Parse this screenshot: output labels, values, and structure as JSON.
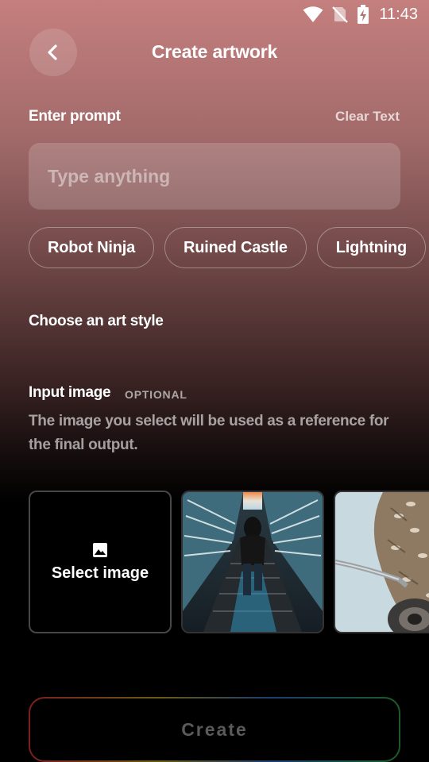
{
  "status_bar": {
    "time": "11:43",
    "icons": [
      "wifi-icon",
      "no-sim-icon",
      "battery-charging-icon"
    ]
  },
  "header": {
    "back_icon": "chevron-left-icon",
    "title": "Create artwork"
  },
  "prompt": {
    "label": "Enter prompt",
    "clear_label": "Clear Text",
    "placeholder": "Type anything",
    "value": ""
  },
  "suggestions": [
    "Robot Ninja",
    "Ruined Castle",
    "Lightning"
  ],
  "art_style": {
    "label": "Choose an art style"
  },
  "input_image": {
    "label": "Input image",
    "badge": "OPTIONAL",
    "description": "The image you select will be used as a reference for the final output.",
    "select_label": "Select image",
    "select_icon": "image-icon",
    "samples": [
      "photo-escalator",
      "photo-owl"
    ]
  },
  "actions": {
    "create_label": "Create"
  },
  "colors": {
    "gradient_top": "#c47f7e",
    "background_bottom": "#000000",
    "create_text": "#5a5a5a"
  }
}
